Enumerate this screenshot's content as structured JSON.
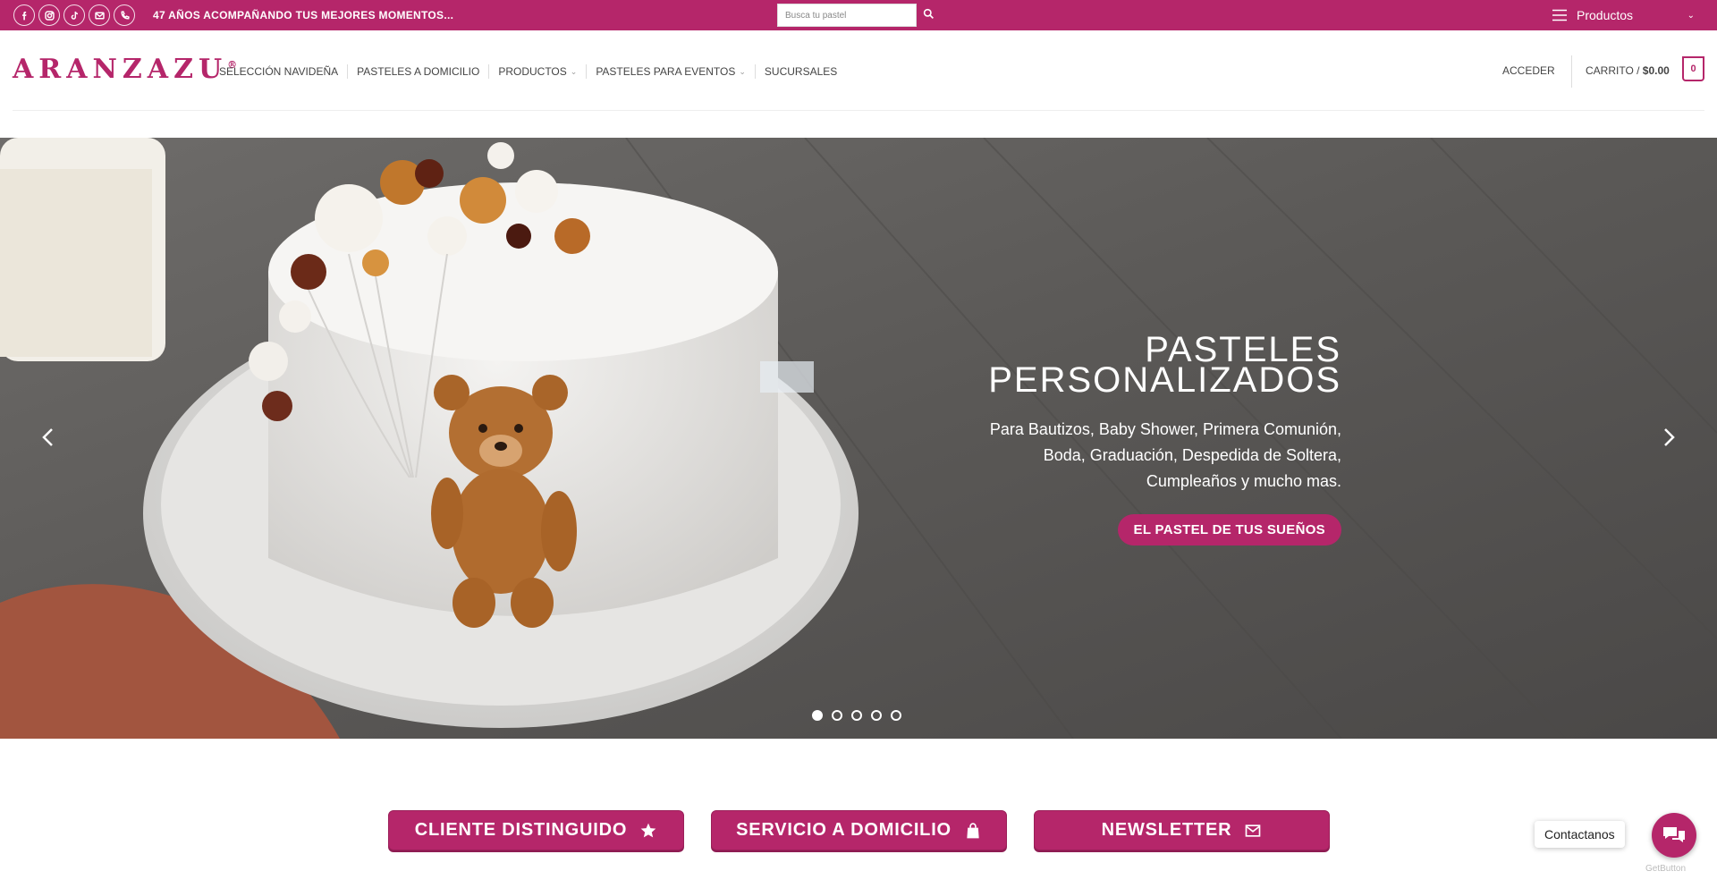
{
  "topbar": {
    "social_icons": [
      "facebook-icon",
      "instagram-icon",
      "tiktok-icon",
      "email-icon",
      "phone-icon"
    ],
    "tagline": "47 AÑOS ACOMPAÑANDO TUS MEJORES MOMENTOS...",
    "search_placeholder": "Busca tu pastel",
    "products_menu_label": "Productos",
    "bg_color": "#b5266a"
  },
  "header": {
    "logo_text": "ARANZAZU",
    "logo_mark": "®",
    "nav": [
      {
        "label": "SELECCIÓN NAVIDEÑA",
        "dropdown": false
      },
      {
        "label": "PASTELES A DOMICILIO",
        "dropdown": false
      },
      {
        "label": "PRODUCTOS",
        "dropdown": true
      },
      {
        "label": "PASTELES PARA EVENTOS",
        "dropdown": true
      },
      {
        "label": "SUCURSALES",
        "dropdown": false
      }
    ],
    "login_label": "ACCEDER",
    "cart_label": "CARRITO /",
    "cart_total": "$0.00",
    "cart_count": "0"
  },
  "hero": {
    "title_line1": "PASTELES",
    "title_line2": "PERSONALIZADOS",
    "subtitle_line1": "Para Bautizos, Baby Shower, Primera Comunión,",
    "subtitle_line2": "Boda, Graduación, Despedida de Soltera,",
    "subtitle_line3": "Cumpleaños y mucho mas.",
    "button_label": "EL PASTEL DE TUS SUEÑOS",
    "slide_count": 5,
    "active_slide": 1
  },
  "cta_buttons": [
    {
      "label": "CLIENTE DISTINGUIDO",
      "icon": "star-icon"
    },
    {
      "label": "SERVICIO A DOMICILIO",
      "icon": "shopping-bag-icon"
    },
    {
      "label": "NEWSLETTER",
      "icon": "envelope-icon"
    }
  ],
  "contact_widget": {
    "tooltip": "Contactanos",
    "credit": "GetButton"
  }
}
